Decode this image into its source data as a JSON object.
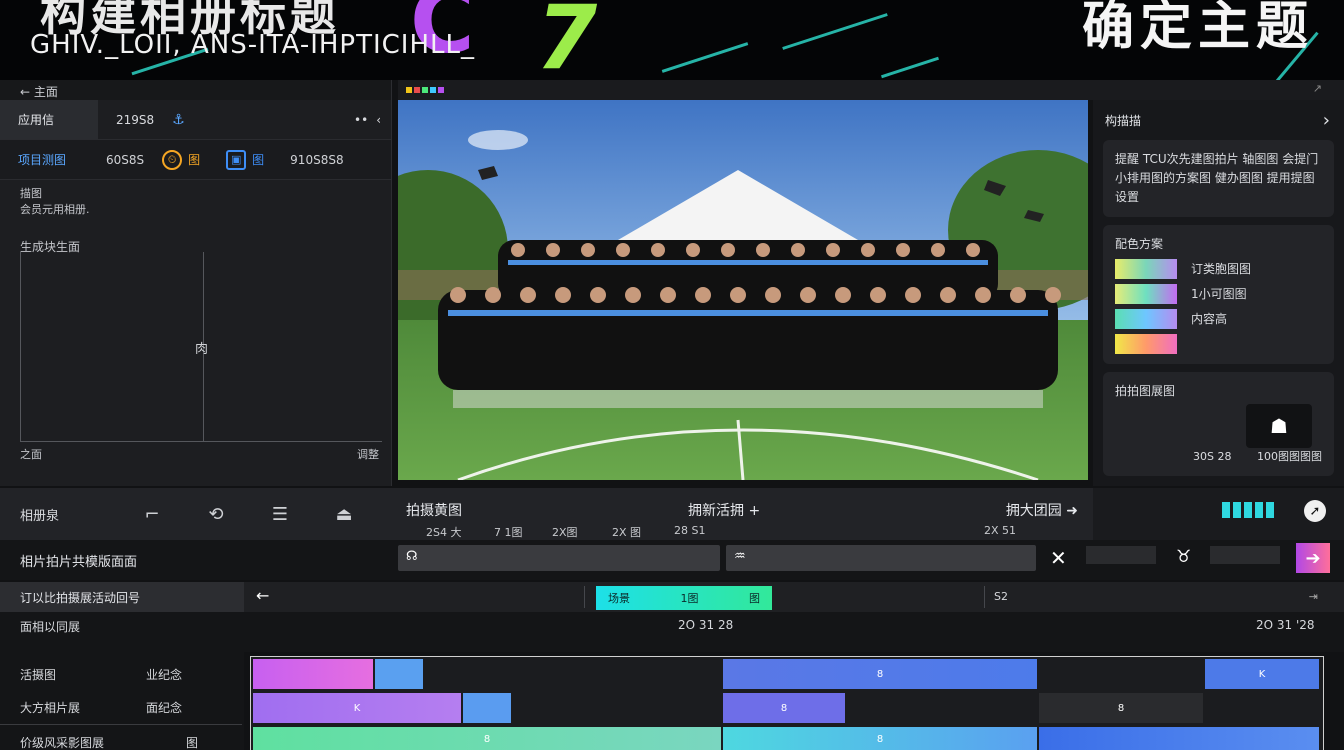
{
  "banner": {
    "title_left": "构建相册标题",
    "subtitle": "GHIV._LOII, ANS-ITA-IHPTICIHLL_",
    "title_right": "确定主题"
  },
  "left_panel": {
    "back_label": "← 主面",
    "row1": {
      "tab": "应用信",
      "value": "219S8",
      "icon": "anchor-icon",
      "icon_glyph": "⚓",
      "more": "••",
      "chev": "‹"
    },
    "row2": {
      "tab": "项目测图",
      "value": "60S8S",
      "btn1": "图",
      "btn2": "图",
      "value2": "910S8S8"
    },
    "desc_title": "描图",
    "desc_body": "会员元用相册.",
    "section": "生成块生面",
    "plot_center": "肉",
    "axis_left": "之面",
    "axis_right": "调整"
  },
  "right_panel": {
    "header": "构描描",
    "header_chev": "›",
    "info_text": "提醒 TCU次先建图拍片 轴图图 会提门小排用图的方案图 健办图图 提用提图设置",
    "palette_title": "配色方案",
    "swatches": [
      {
        "label": "订类胞图图",
        "color": "#7ad6b9"
      },
      {
        "label": "1小可图图",
        "color": "#e6ec78"
      },
      {
        "label": "内容高",
        "color": "#5bdfb2"
      },
      {
        "label": "",
        "color": "#f0e848"
      }
    ],
    "export_title": "拍拍图展图",
    "export_left": "30S 28",
    "export_right": "100图图图图",
    "user_icon": "☗"
  },
  "toolbar": {
    "label": "相册泉",
    "t1": "拍摄黄图",
    "t2": "拥新活拥 +",
    "t3": "拥大团园 ➜",
    "nums": [
      "2S4 大",
      "7 1图",
      "2X图",
      "2X 图",
      "28 S1",
      "2X 51"
    ]
  },
  "search": {
    "label": "相片拍片共模版面面",
    "field1_icon": "☊",
    "field2_icon": "♒",
    "close": "✕",
    "gender": "♉",
    "go": "➔"
  },
  "timeline": {
    "left_label": "订以比拍摄展活动回号",
    "back": "←",
    "clip_a": "场景",
    "clip_b": "1图",
    "clip_c": "图",
    "marker": "S2",
    "end": "⇥",
    "times_label": "面相以同展",
    "time_mid": "2O 31 28",
    "time_right": "2O 31 '28",
    "tracks": [
      {
        "label": "活摄图",
        "tag": "业纪念"
      },
      {
        "label": "大方相片展",
        "tag": "面纪念"
      },
      {
        "label": "价级风采影图展",
        "tag": "图"
      }
    ],
    "seg_labels": [
      "8",
      "K",
      "8",
      "8",
      "8",
      "8"
    ]
  }
}
